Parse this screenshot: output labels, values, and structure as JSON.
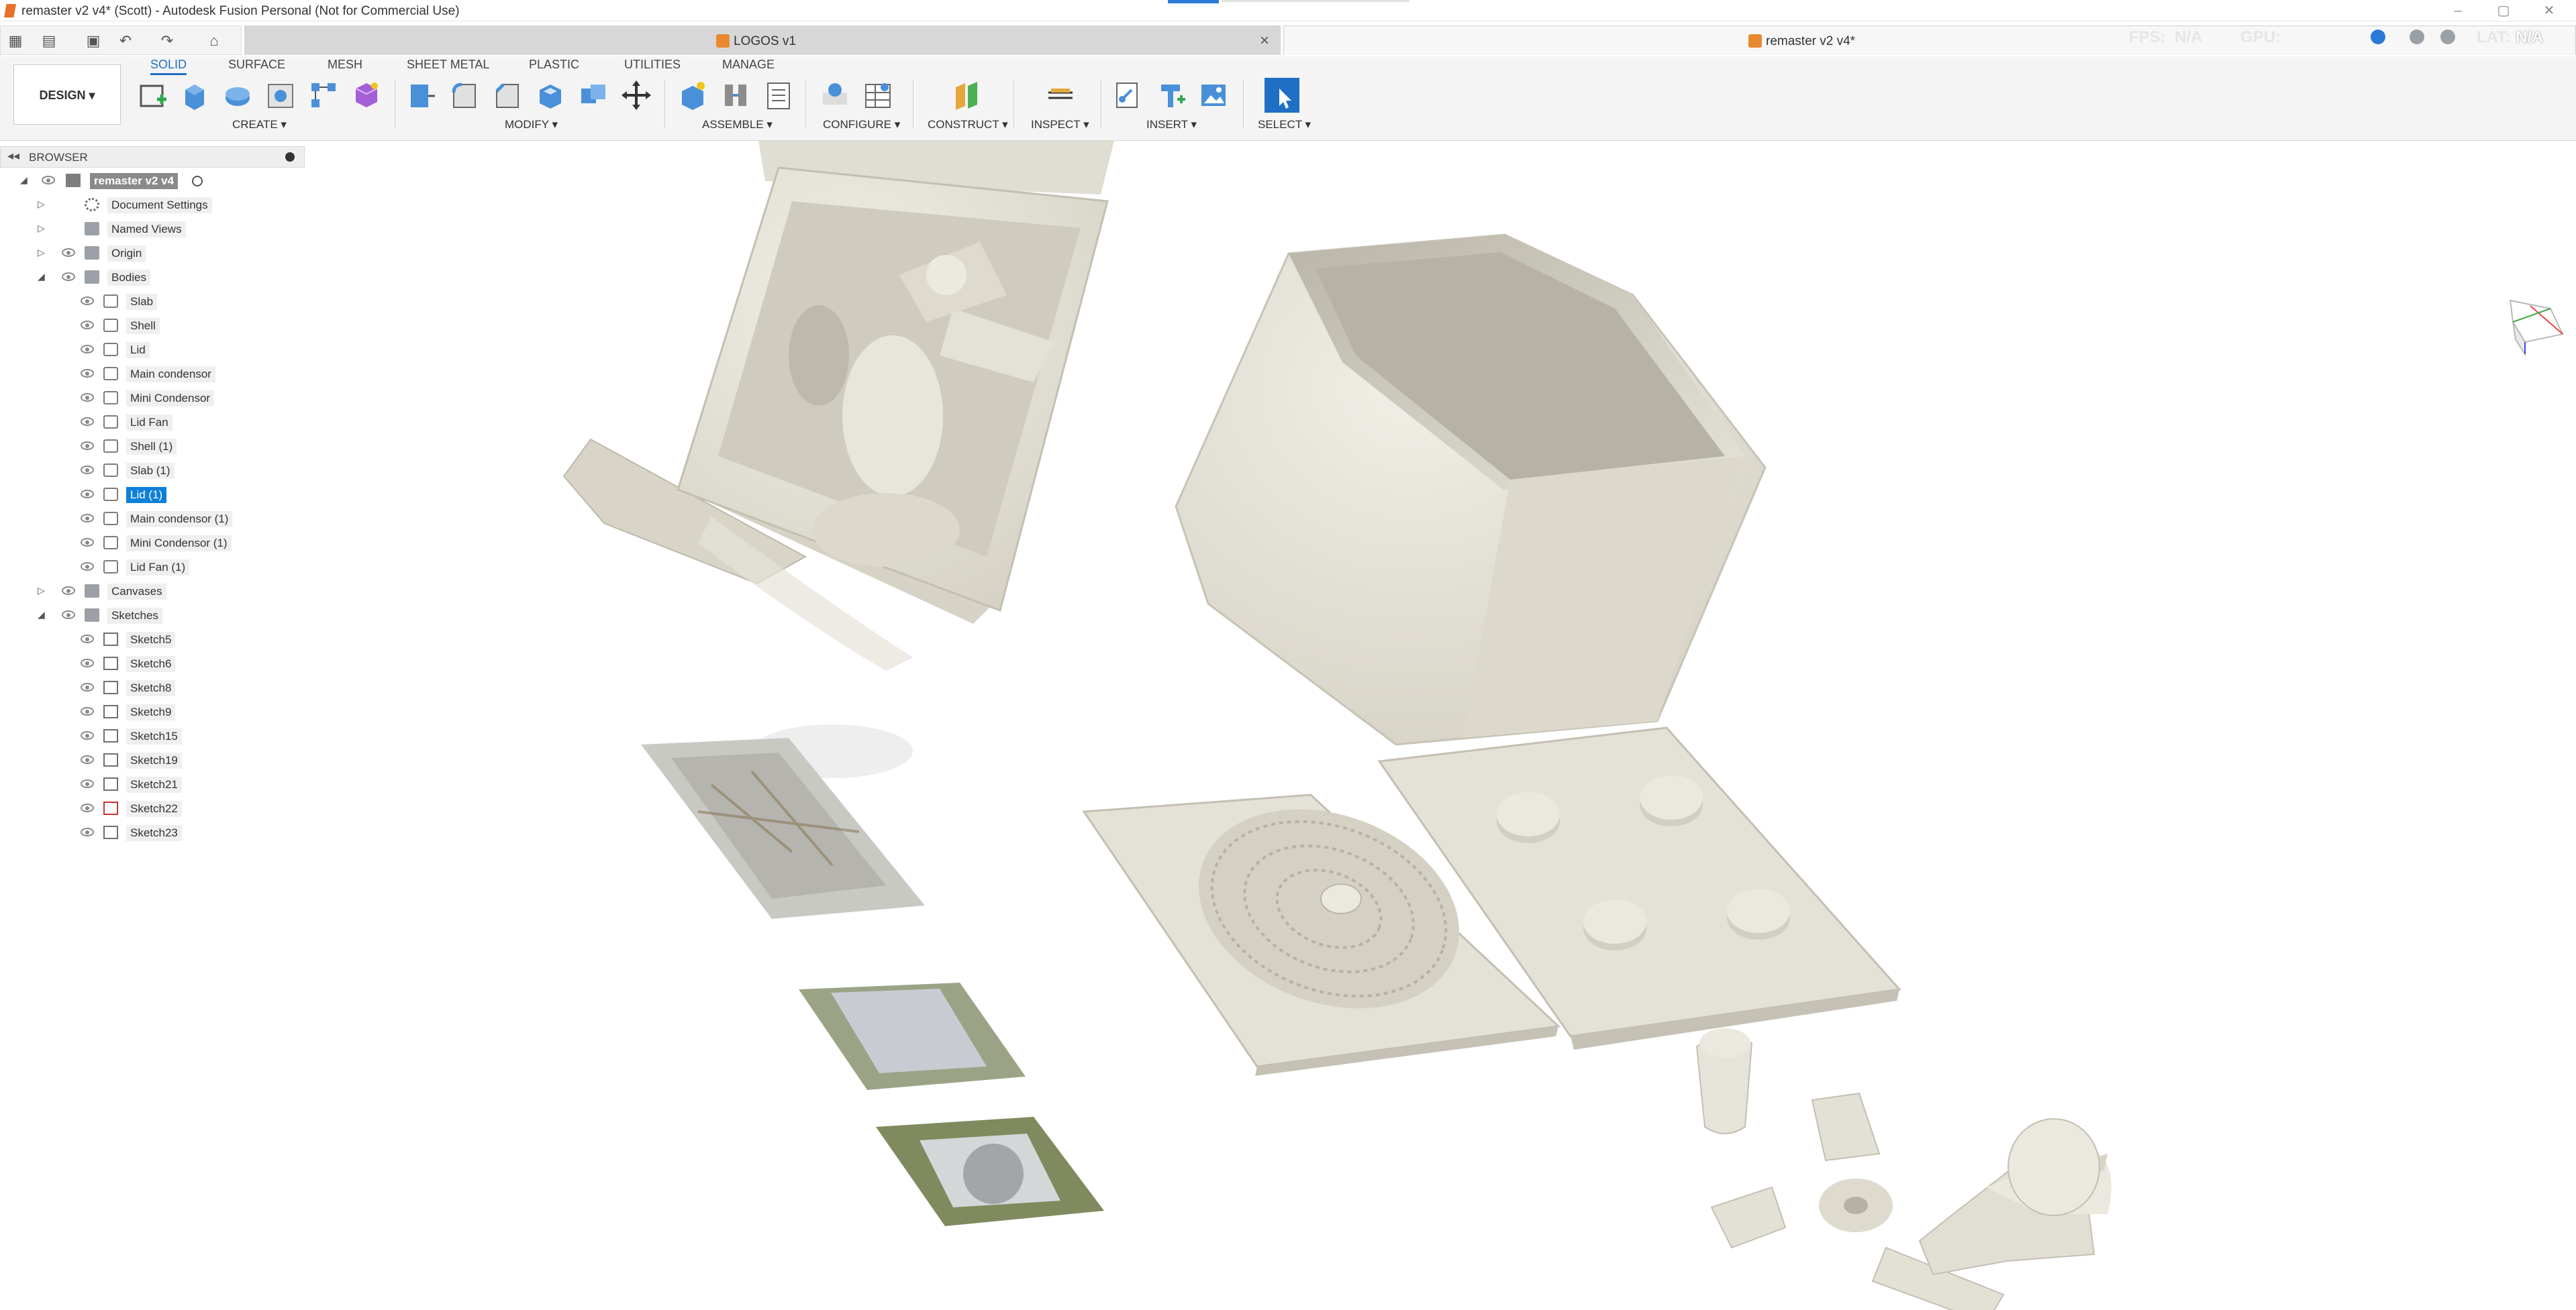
{
  "window": {
    "title": "remaster v2 v4* (Scott) - Autodesk Fusion Personal (Not for Commercial Use)"
  },
  "tabs": [
    {
      "label": "LOGOS v1",
      "active": false
    },
    {
      "label": "remaster v2 v4*",
      "active": true
    }
  ],
  "status": {
    "fps_label": "FPS:",
    "fps_value": "N/A",
    "gpu_label": "GPU:",
    "lat_label": "LAT:",
    "lat_value": "N/A"
  },
  "ribbon": {
    "workspace": "DESIGN",
    "tabs": [
      "SOLID",
      "SURFACE",
      "MESH",
      "SHEET METAL",
      "PLASTIC",
      "UTILITIES",
      "MANAGE"
    ],
    "active_tab": "SOLID",
    "groups": [
      "CREATE",
      "MODIFY",
      "ASSEMBLE",
      "CONFIGURE",
      "CONSTRUCT",
      "INSPECT",
      "INSERT",
      "SELECT"
    ]
  },
  "browser": {
    "header": "BROWSER",
    "root": "remaster v2 v4",
    "items": [
      {
        "label": "Document Settings",
        "icon": "gear-icon",
        "level": 1,
        "expand": "collapsed",
        "eye": false
      },
      {
        "label": "Named Views",
        "icon": "folder-icon",
        "level": 1,
        "expand": "collapsed",
        "eye": false
      },
      {
        "label": "Origin",
        "icon": "folder-icon",
        "level": 1,
        "expand": "collapsed",
        "eye": true
      },
      {
        "label": "Bodies",
        "icon": "folder-icon",
        "level": 1,
        "expand": "expanded",
        "eye": true
      },
      {
        "label": "Slab",
        "icon": "body-icon",
        "level": 2,
        "eye": true
      },
      {
        "label": "Shell",
        "icon": "body-icon",
        "level": 2,
        "eye": true
      },
      {
        "label": "Lid",
        "icon": "body-icon",
        "level": 2,
        "eye": true
      },
      {
        "label": "Main condensor",
        "icon": "body-icon",
        "level": 2,
        "eye": true
      },
      {
        "label": "Mini Condensor",
        "icon": "body-icon",
        "level": 2,
        "eye": true
      },
      {
        "label": "Lid Fan",
        "icon": "body-icon",
        "level": 2,
        "eye": true
      },
      {
        "label": "Shell (1)",
        "icon": "body-icon",
        "level": 2,
        "eye": true
      },
      {
        "label": "Slab (1)",
        "icon": "body-icon",
        "level": 2,
        "eye": true
      },
      {
        "label": "Lid (1)",
        "icon": "body-icon",
        "level": 2,
        "eye": true,
        "selected": true
      },
      {
        "label": "Main condensor (1)",
        "icon": "body-icon",
        "level": 2,
        "eye": true
      },
      {
        "label": "Mini Condensor (1)",
        "icon": "body-icon",
        "level": 2,
        "eye": true
      },
      {
        "label": "Lid Fan (1)",
        "icon": "body-icon",
        "level": 2,
        "eye": true
      },
      {
        "label": "Canvases",
        "icon": "folder-icon",
        "level": 1,
        "expand": "collapsed",
        "eye": true
      },
      {
        "label": "Sketches",
        "icon": "folder-icon",
        "level": 1,
        "expand": "expanded",
        "eye": true
      },
      {
        "label": "Sketch5",
        "icon": "sketch-icon",
        "level": 2,
        "eye": true
      },
      {
        "label": "Sketch6",
        "icon": "sketch-icon",
        "level": 2,
        "eye": true
      },
      {
        "label": "Sketch8",
        "icon": "sketch-icon",
        "level": 2,
        "eye": true
      },
      {
        "label": "Sketch9",
        "icon": "sketch-icon",
        "level": 2,
        "eye": true
      },
      {
        "label": "Sketch15",
        "icon": "sketch-icon",
        "level": 2,
        "eye": true
      },
      {
        "label": "Sketch19",
        "icon": "sketch-icon",
        "level": 2,
        "eye": true
      },
      {
        "label": "Sketch21",
        "icon": "sketch-icon",
        "level": 2,
        "eye": true
      },
      {
        "label": "Sketch22",
        "icon": "sketch-error-icon",
        "level": 2,
        "eye": true
      },
      {
        "label": "Sketch23",
        "icon": "sketch-icon",
        "level": 2,
        "eye": true
      }
    ]
  },
  "colors": {
    "model": "#e4e1d6",
    "model_shade": "#c9c5b8",
    "selection": "#0e80d8",
    "accent": "#1f6fc5"
  }
}
